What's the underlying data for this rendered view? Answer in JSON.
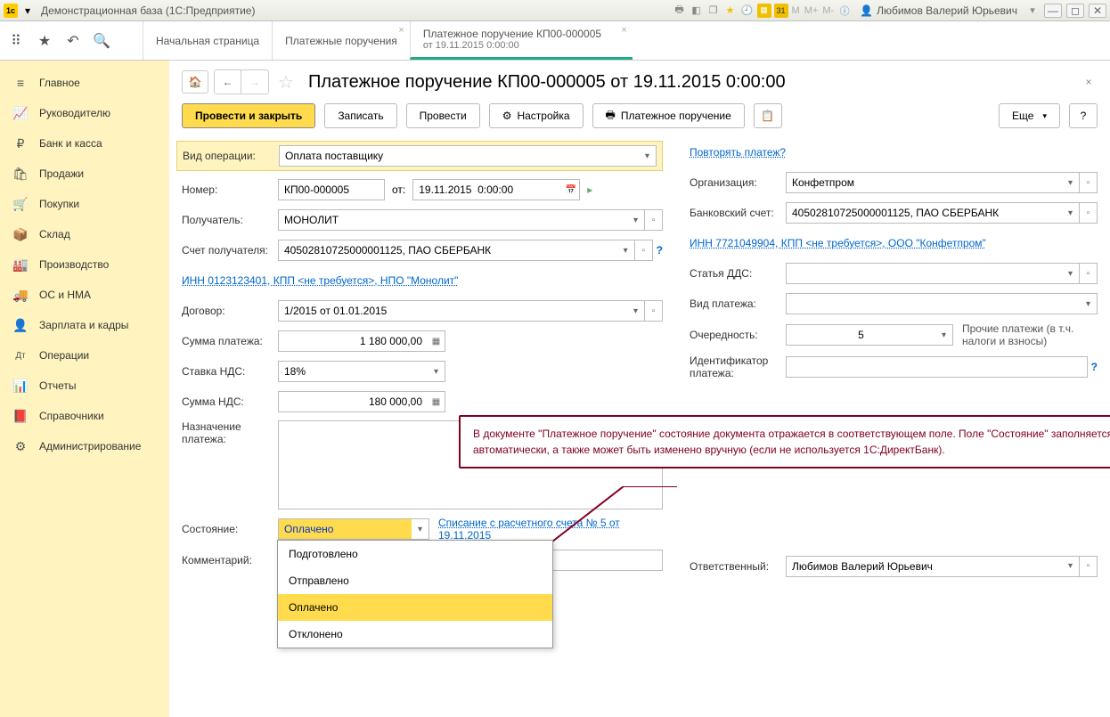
{
  "titlebar": {
    "app_title": "Демонстрационная база  (1С:Предприятие)",
    "user_name": "Любимов Валерий Юрьевич"
  },
  "topTabs": [
    {
      "label": "Начальная страница"
    },
    {
      "label": "Платежные поручения"
    },
    {
      "label": "Платежное поручение КП00-000005",
      "sub": "от 19.11.2015 0:00:00"
    }
  ],
  "sidebar": [
    {
      "icon": "≡",
      "label": "Главное"
    },
    {
      "icon": "📈",
      "label": "Руководителю"
    },
    {
      "icon": "₽",
      "label": "Банк и касса"
    },
    {
      "icon": "🛍",
      "label": "Продажи"
    },
    {
      "icon": "🛒",
      "label": "Покупки"
    },
    {
      "icon": "📦",
      "label": "Склад"
    },
    {
      "icon": "🏭",
      "label": "Производство"
    },
    {
      "icon": "🚚",
      "label": "ОС и НМА"
    },
    {
      "icon": "👤",
      "label": "Зарплата и кадры"
    },
    {
      "icon": "Дт",
      "label": "Операции"
    },
    {
      "icon": "📊",
      "label": "Отчеты"
    },
    {
      "icon": "📕",
      "label": "Справочники"
    },
    {
      "icon": "⚙",
      "label": "Администрирование"
    }
  ],
  "doc": {
    "title": "Платежное поручение КП00-000005 от 19.11.2015 0:00:00",
    "btn_post_close": "Провести и закрыть",
    "btn_save": "Записать",
    "btn_post": "Провести",
    "btn_settings": "Настройка",
    "btn_print": "Платежное поручение",
    "btn_more": "Еще",
    "labels": {
      "op_type": "Вид операции:",
      "number": "Номер:",
      "from": "от:",
      "recipient": "Получатель:",
      "recip_account": "Счет получателя:",
      "contract": "Договор:",
      "pay_sum": "Сумма платежа:",
      "vat_rate": "Ставка НДС:",
      "vat_sum": "Сумма НДС:",
      "purpose": "Назначение платежа:",
      "status": "Состояние:",
      "comment": "Комментарий:",
      "org": "Организация:",
      "bank_account": "Банковский счет:",
      "dds": "Статья ДДС:",
      "pay_type": "Вид платежа:",
      "priority": "Очередность:",
      "pay_id": "Идентификатор платежа:",
      "responsible": "Ответственный:"
    },
    "values": {
      "op_type": "Оплата поставщику",
      "number": "КП00-000005",
      "date": "19.11.2015  0:00:00",
      "recipient": "МОНОЛИТ",
      "recip_account": "40502810725000001125, ПАО СБЕРБАНК",
      "recip_inn_link": "ИНН 0123123401, КПП <не требуется>, НПО \"Монолит\"",
      "contract": "1/2015 от 01.01.2015",
      "pay_sum": "1 180 000,00",
      "vat_rate": "18%",
      "vat_sum": "180 000,00",
      "status": "Оплачено",
      "writeoff_link": "Списание с расчетного счета № 5 от 19.11.2015",
      "org": "Конфетпром",
      "bank_account": "40502810725000001125, ПАО СБЕРБАНК",
      "org_inn_link": "ИНН 7721049904, КПП <не требуется>, ООО \"Конфетпром\"",
      "priority": "5",
      "priority_desc": "Прочие платежи (в т.ч. налоги и взносы)",
      "responsible": "Любимов Валерий Юрьевич",
      "repeat_link": "Повторять платеж?"
    },
    "status_options": [
      "Подготовлено",
      "Отправлено",
      "Оплачено",
      "Отклонено"
    ],
    "callout": "В документе \"Платежное поручение\" состояние документа отражается в соответствующем поле. Поле \"Состояние\" заполняется автоматически, а также может быть изменено вручную (если не используется 1С:ДиректБанк)."
  }
}
